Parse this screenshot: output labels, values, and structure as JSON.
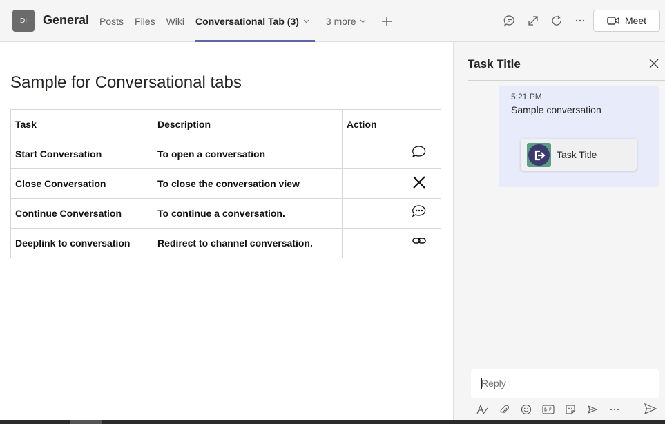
{
  "header": {
    "team_avatar": "DI",
    "channel_name": "General",
    "tabs": [
      {
        "label": "Posts"
      },
      {
        "label": "Files"
      },
      {
        "label": "Wiki"
      },
      {
        "label": "Conversational Tab (3)"
      },
      {
        "label": "3 more"
      }
    ],
    "add_tab_icon": "plus-icon",
    "meet_label": "Meet"
  },
  "main": {
    "title": "Sample for Conversational tabs",
    "columns": [
      "Task",
      "Description",
      "Action"
    ],
    "rows": [
      {
        "task": "Start Conversation",
        "description": "To open a conversation",
        "icon": "chat-icon"
      },
      {
        "task": "Close Conversation",
        "description": "To close the conversation view",
        "icon": "close-icon"
      },
      {
        "task": "Continue Conversation",
        "description": "To continue a conversation.",
        "icon": "chat-dots-icon"
      },
      {
        "task": "Deeplink to conversation",
        "description": "Redirect to channel conversation.",
        "icon": "link-icon"
      }
    ]
  },
  "panel": {
    "title": "Task Title",
    "message": {
      "time": "5:21 PM",
      "text": "Sample conversation",
      "card_title": "Task Title"
    },
    "reply_placeholder": "Reply"
  },
  "colors": {
    "accent": "#6264a7",
    "message_bg": "#e8ebfa"
  }
}
